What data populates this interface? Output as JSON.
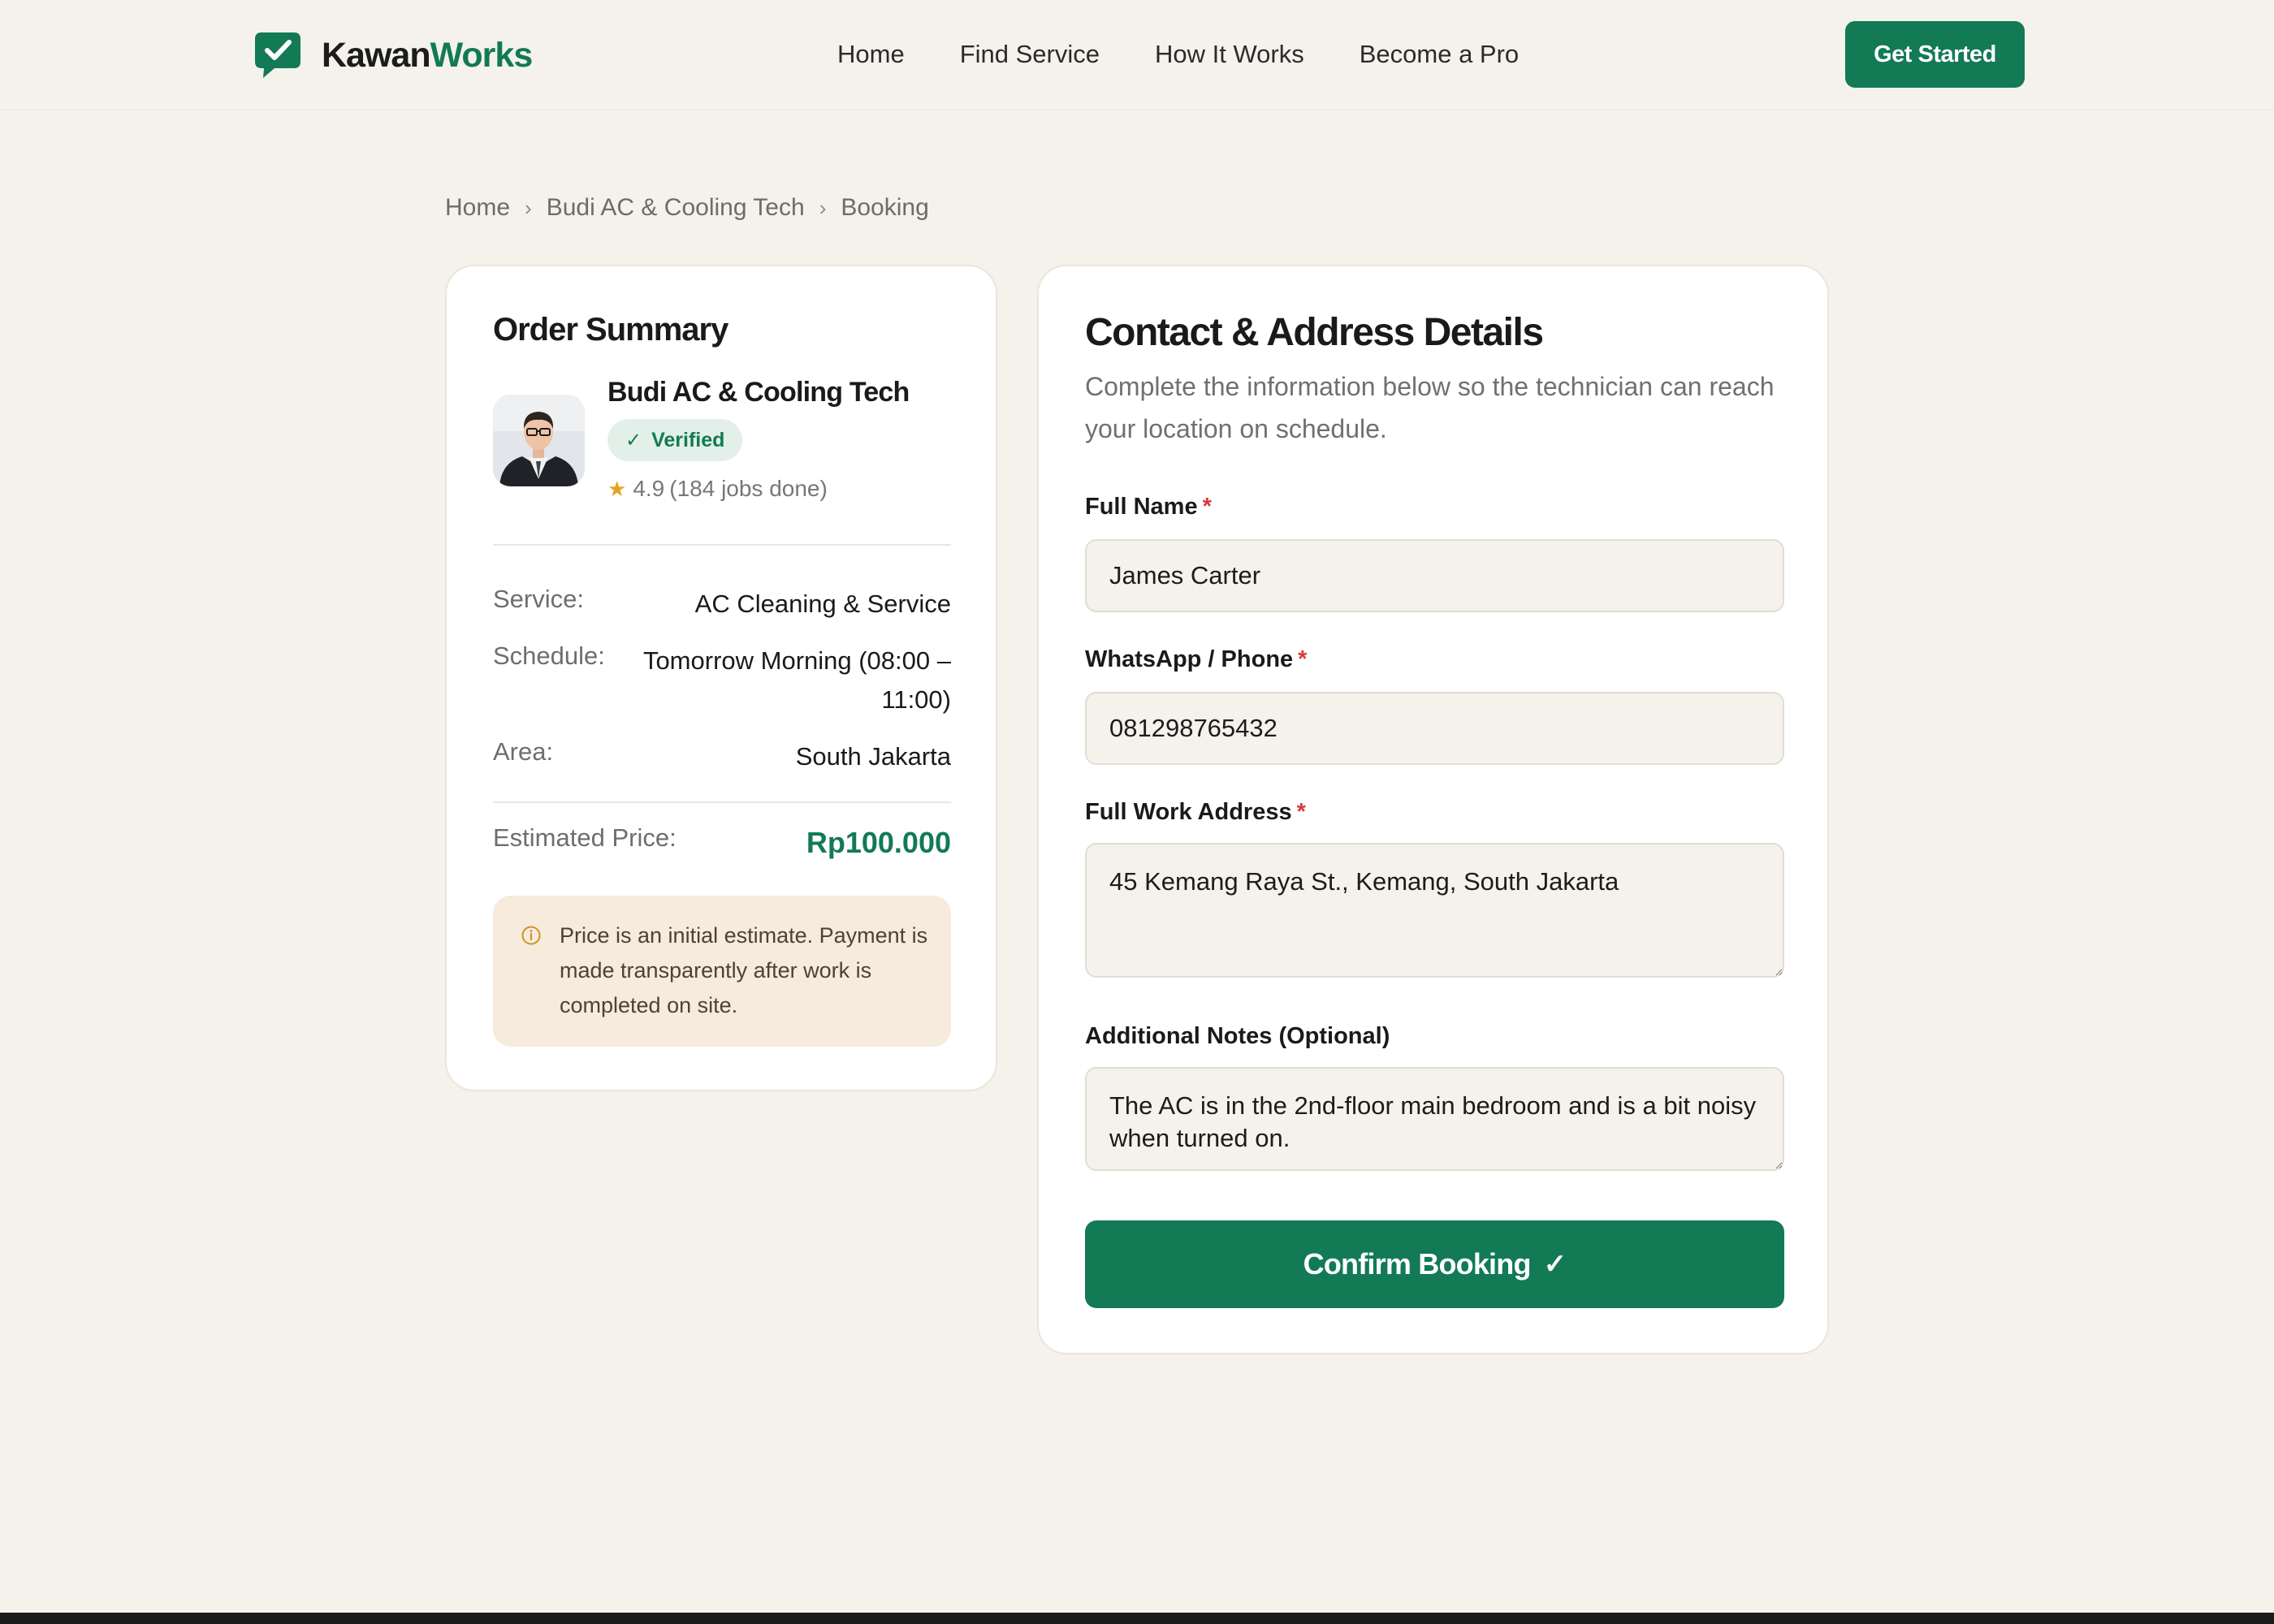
{
  "brand": {
    "name_part1": "Kawan",
    "name_part2": "Works",
    "accent_color": "#127a55",
    "logo_icon": "chat-check-icon"
  },
  "nav": {
    "items": [
      "Home",
      "Find Service",
      "How It Works",
      "Become a Pro"
    ],
    "cta_label": "Get Started"
  },
  "breadcrumb": {
    "items": [
      "Home",
      "Budi AC & Cooling Tech",
      "Booking"
    ],
    "separator": "›"
  },
  "summary": {
    "title": "Order Summary",
    "provider": {
      "name": "Budi AC & Cooling Tech",
      "badge": "Verified",
      "badge_icon": "check-icon",
      "rating": "4.9",
      "jobs": "(184 jobs done)"
    },
    "rows": [
      {
        "label": "Service:",
        "value": "AC Cleaning & Service"
      },
      {
        "label": "Schedule:",
        "value": "Tomorrow Morning (08:00 – 11:00)"
      },
      {
        "label": "Area:",
        "value": "South Jakarta"
      }
    ],
    "price_label": "Estimated Price:",
    "price_value": "Rp100.000",
    "notice": "Price is an initial estimate. Payment is made transparently after work is completed on site."
  },
  "form": {
    "title": "Contact & Address Details",
    "subtitle": "Complete the information below so the technician can reach your location on schedule.",
    "full_name": {
      "label": "Full Name",
      "required_mark": "*",
      "value": "James Carter"
    },
    "phone": {
      "label": "WhatsApp / Phone",
      "required_mark": "*",
      "value": "081298765432"
    },
    "address": {
      "label": "Full Work Address",
      "required_mark": "*",
      "value": "45 Kemang Raya St., Kemang, South Jakarta"
    },
    "notes": {
      "label": "Additional Notes (Optional)",
      "value": "The AC is in the 2nd-floor main bedroom and is a bit noisy when turned on."
    },
    "submit_label": "Confirm Booking",
    "submit_icon": "checkmark"
  }
}
